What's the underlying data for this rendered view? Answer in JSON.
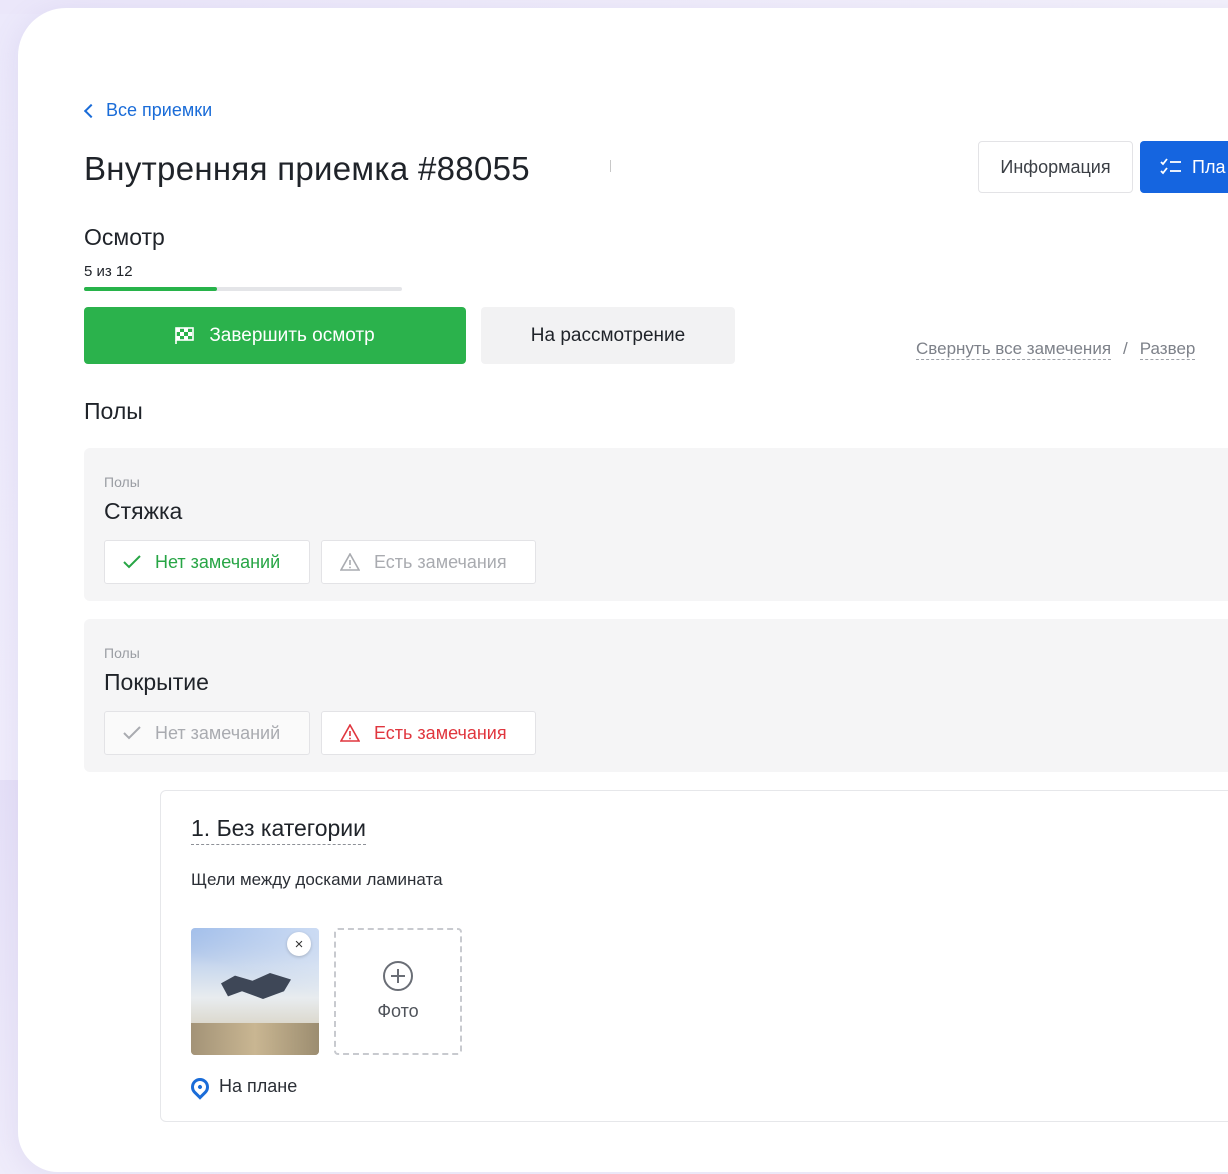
{
  "back_link": {
    "label": "Все приемки"
  },
  "header": {
    "title": "Внутренняя приемка #88055",
    "info_button": "Информация",
    "plan_button": "Пла"
  },
  "inspection": {
    "section_title": "Осмотр",
    "progress_text": "5 из 12",
    "progress_fraction": 0.4167,
    "finish_button": "Завершить осмотр",
    "review_button": "На рассмотрение",
    "collapse_all": "Свернуть все замечения",
    "separator": "/",
    "expand_all": "Развер"
  },
  "floors": {
    "heading": "Полы",
    "items": [
      {
        "category": "Полы",
        "name": "Стяжка",
        "no_issues": "Нет замечаний",
        "has_issues": "Есть замечания",
        "state": "ok"
      },
      {
        "category": "Полы",
        "name": "Покрытие",
        "no_issues": "Нет замечаний",
        "has_issues": "Есть замечания",
        "state": "issues"
      }
    ]
  },
  "issue": {
    "title": "1. Без категории",
    "description": "Щели между досками ламината",
    "close_symbol": "×",
    "add_photo_label": "Фото",
    "on_plan_label": "На плане"
  },
  "colors": {
    "accent_blue": "#1565e0",
    "success_green": "#2bb24c",
    "danger_red": "#e0363e"
  },
  "icons": [
    "chevron-left-icon",
    "checklist-icon",
    "flag-icon",
    "check-icon",
    "warning-icon",
    "close-icon",
    "plus-circle-icon",
    "location-pin-icon"
  ]
}
